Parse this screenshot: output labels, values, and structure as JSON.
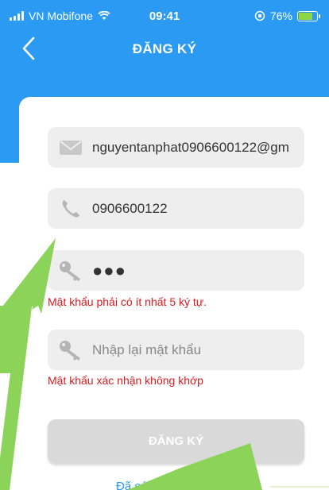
{
  "status_bar": {
    "carrier": "VN Mobifone",
    "time": "09:41",
    "battery_percent": "76%",
    "battery_level": 0.76
  },
  "header": {
    "title": "ĐĂNG KÝ"
  },
  "form": {
    "email": {
      "value": "nguyentanphat0906600122@gm",
      "icon": "envelope-icon"
    },
    "phone": {
      "value": "0906600122",
      "icon": "phone-icon"
    },
    "password": {
      "value": "●●●",
      "icon": "key-icon",
      "error": "Mật khẩu phải có ít nhất 5 ký tự."
    },
    "confirm_password": {
      "placeholder": "Nhập lại mật khẩu",
      "icon": "key-icon",
      "error": "Mật khẩu xác nhận không khớp"
    },
    "submit_label": "ĐĂNG KÝ",
    "login_link": "Đã có tài"
  },
  "colors": {
    "header": "#2b9af3",
    "field_bg": "#eeeeee",
    "error": "#e0191e",
    "button_disabled": "#d9d9d9",
    "link": "#2b9af3",
    "annotation_arrow": "#8cd35a"
  }
}
